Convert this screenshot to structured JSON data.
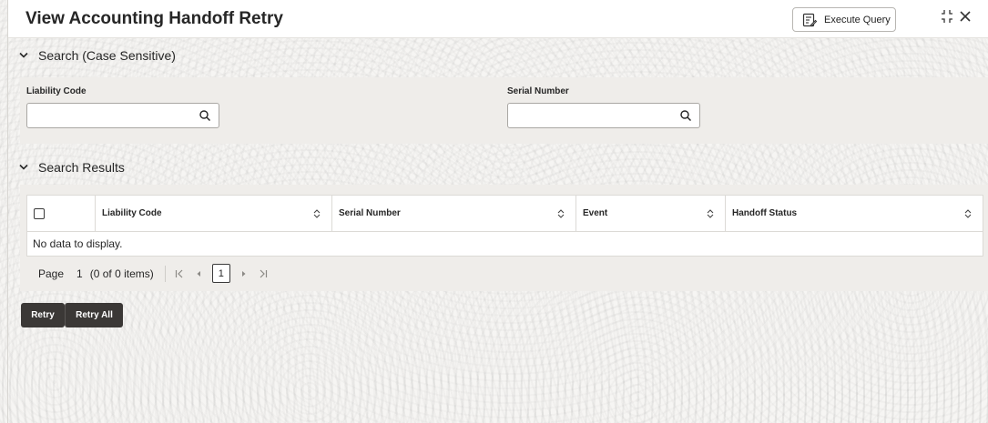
{
  "header": {
    "title": "View Accounting Handoff Retry",
    "execute_query_label": "Execute Query",
    "icons": [
      "execute-query-icon",
      "collapse-icon",
      "close-icon"
    ]
  },
  "search": {
    "section_title": "Search (Case Sensitive)",
    "fields": [
      {
        "label": "Liability Code",
        "value": "",
        "placeholder": ""
      },
      {
        "label": "Serial Number",
        "value": "",
        "placeholder": ""
      }
    ]
  },
  "results": {
    "section_title": "Search Results",
    "columns": [
      "Liability Code",
      "Serial Number",
      "Event",
      "Handoff Status"
    ],
    "rows": [],
    "empty_message": "No data to display.",
    "pagination": {
      "page_label": "Page",
      "current_page": "1",
      "items_text": "(0 of 0 items)",
      "page_button": "1"
    }
  },
  "actions": {
    "retry_label": "Retry",
    "retry_all_label": "Retry All"
  },
  "colors": {
    "action_button_bg": "#3b3836",
    "panel_bg": "#efedea",
    "header_bg": "#ffffff"
  }
}
